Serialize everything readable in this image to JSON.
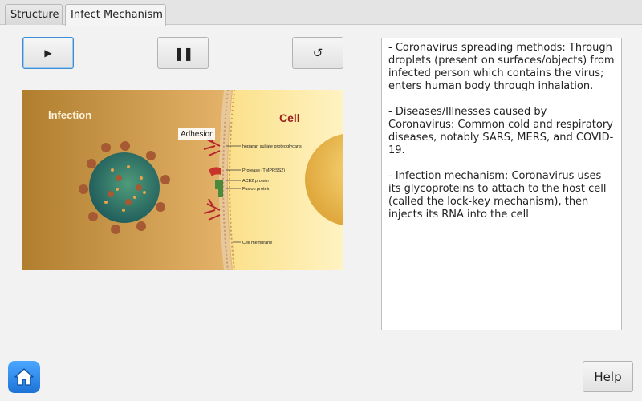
{
  "tabs": [
    {
      "label": "Structure"
    },
    {
      "label": "Infect Mechanism"
    }
  ],
  "controls": {
    "play_glyph": "▶",
    "pause_glyph": "❚❚",
    "reset_glyph": "↺"
  },
  "illustration": {
    "infection_label": "Infection",
    "cell_label": "Cell",
    "adhesion_label": "Adhesion",
    "annotations": [
      "heparan sulfate proteoglycans",
      "Protease (TMPRSS2)",
      "ACE2 protein",
      "Fusion protein",
      "Cell membrane"
    ]
  },
  "info_text": [
    "- Coronavirus spreading methods: Through droplets (present on surfaces/objects) from infected person which contains the virus; enters human body through inhalation.",
    "- Diseases/Illnesses caused by Coronavirus: Common cold and respiratory diseases, notably SARS, MERS, and COVID-19.",
    "- Infection mechanism: Coronavirus uses its glycoproteins to attach to the host cell (called the lock-key mechanism), then injects its RNA into the cell"
  ],
  "help_label": "Help",
  "icons": {
    "play": "play-icon",
    "pause": "pause-icon",
    "reset": "reset-icon",
    "home": "home-icon"
  },
  "colors": {
    "accent": "#3d8ed3",
    "home_button": "#1d73d6"
  }
}
